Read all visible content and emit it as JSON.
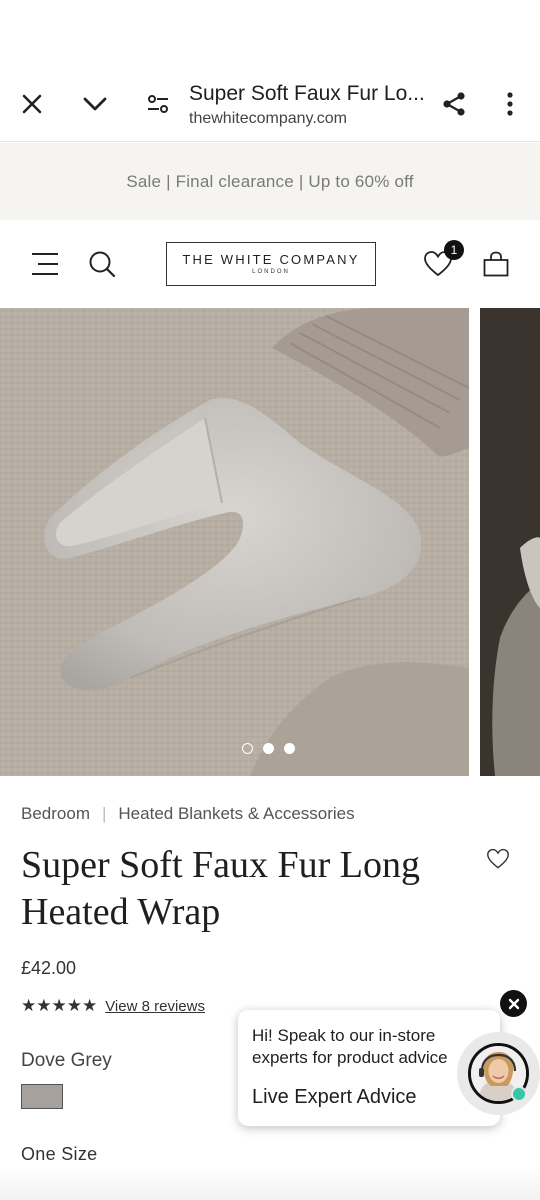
{
  "browser": {
    "title": "Super Soft Faux Fur Lo...",
    "url": "thewhitecompany.com",
    "icons": [
      "close-icon",
      "chevron-down-icon",
      "site-settings-icon",
      "share-icon",
      "more-vert-icon"
    ]
  },
  "banner": {
    "text": "Sale | Final clearance | Up to 60% off"
  },
  "header": {
    "logo_main": "THE WHITE COMPANY",
    "logo_sub": "LONDON",
    "wishlist_count": "1",
    "icons": [
      "menu-icon",
      "search-icon",
      "heart-icon",
      "bag-icon"
    ]
  },
  "gallery": {
    "slide_count": 3,
    "active_slide": 1
  },
  "product": {
    "breadcrumb": [
      "Bedroom",
      "Heated Blankets & Accessories"
    ],
    "title": "Super Soft Faux Fur Long Heated Wrap",
    "price": "£42.00",
    "rating": 5,
    "stars": "★★★★★",
    "reviews_link": "View 8 reviews",
    "color_name": "Dove Grey",
    "swatch_color": "#a7a19e",
    "size": "One Size"
  },
  "chat": {
    "message": "Hi! Speak to our in-store experts for product advice",
    "cta": "Live Expert Advice",
    "status_color": "#36c6a8"
  }
}
